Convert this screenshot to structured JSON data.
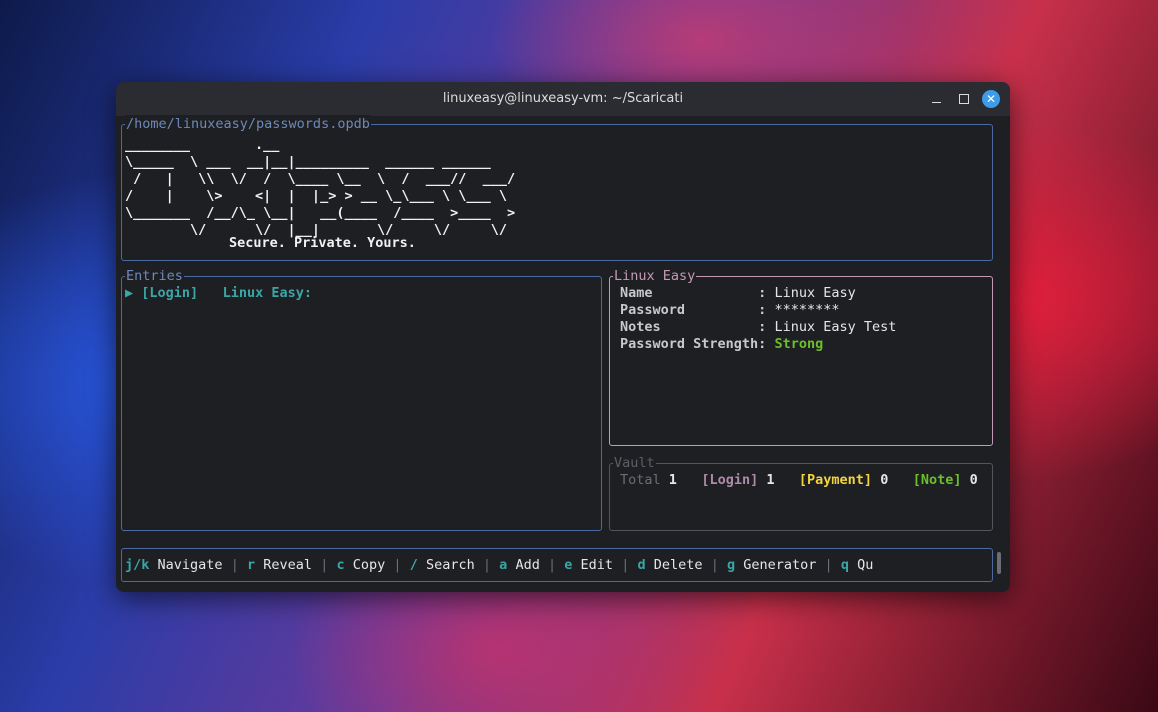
{
  "window": {
    "title": "linuxeasy@linuxeasy-vm: ~/Scaricati",
    "minimize_glyph": "",
    "close_glyph": "✕"
  },
  "header": {
    "path": "/home/linuxeasy/passwords.opdb",
    "ascii_logo": "________        .__\n\\_____  \\ ___  __|__|_________  ______ ______\n /   |   \\\\  \\/  /  \\____ \\__  \\  /  ___//  ___/\n/    |    \\>    <|  |  |_> > __ \\_\\___ \\ \\___ \\\n\\_______  /__/\\_ \\__|   __(____  /____  >____  >\n        \\/      \\/  |__|       \\/     \\/     \\/",
    "tagline": "Secure. Private. Yours."
  },
  "entries": {
    "title": "Entries",
    "items": [
      {
        "marker": "▶",
        "type": "[Login]",
        "name": "Linux Easy:"
      }
    ]
  },
  "detail": {
    "title": "Linux Easy",
    "fields": [
      {
        "label": "Name             ",
        "value": "Linux Easy"
      },
      {
        "label": "Password         ",
        "value": "********"
      },
      {
        "label": "Notes            ",
        "value": "Linux Easy Test"
      },
      {
        "label": "Password Strength",
        "value": "Strong"
      }
    ]
  },
  "vault": {
    "title": "Vault",
    "total_label": "Total",
    "total": "1",
    "login_label": "[Login]",
    "login": "1",
    "payment_label": "[Payment]",
    "payment": "0",
    "note_label": "[Note]",
    "note": "0"
  },
  "footer": {
    "keys": [
      {
        "key": "j/k",
        "label": "Navigate"
      },
      {
        "key": "r",
        "label": "Reveal"
      },
      {
        "key": "c",
        "label": "Copy"
      },
      {
        "key": "/",
        "label": "Search"
      },
      {
        "key": "a",
        "label": "Add"
      },
      {
        "key": "e",
        "label": "Edit"
      },
      {
        "key": "d",
        "label": "Delete"
      },
      {
        "key": "g",
        "label": "Generator"
      },
      {
        "key": "q",
        "label": "Qu"
      }
    ],
    "separator": "|"
  },
  "colors": {
    "accent_teal": "#3aa6a6",
    "border_blue": "#4a6aa0",
    "detail_pink": "#c49ab6",
    "strength_green": "#6cbf2a",
    "payment_yellow": "#f1d440",
    "close_button_blue": "#3d9be9"
  }
}
